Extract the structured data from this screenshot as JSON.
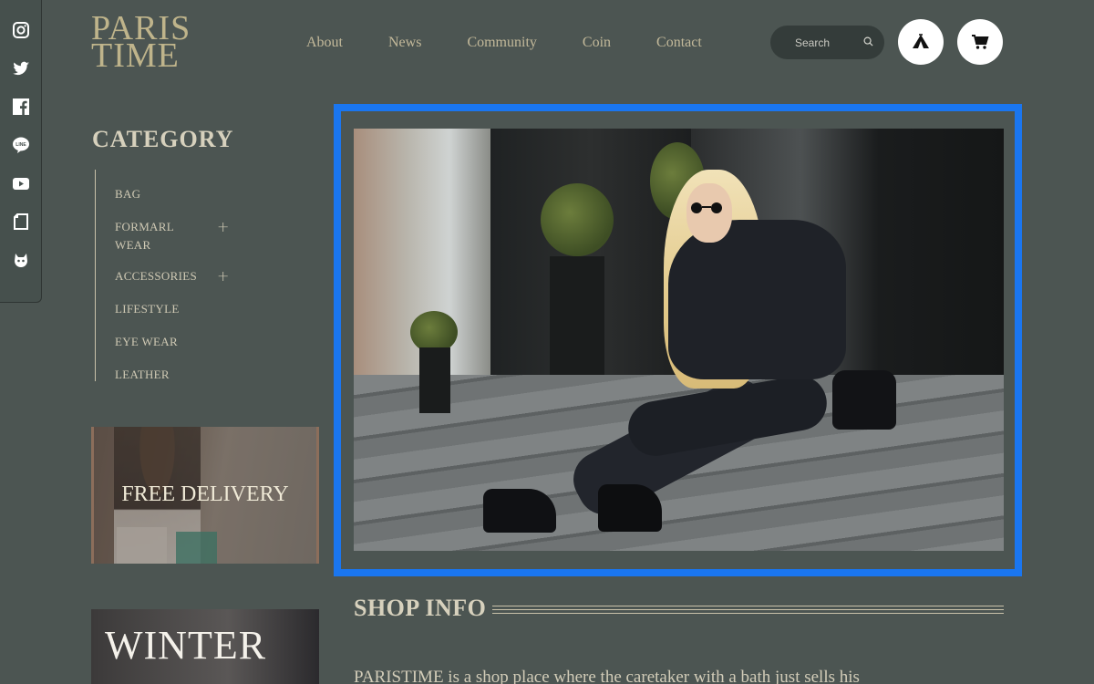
{
  "social": {
    "icons": [
      "instagram-icon",
      "twitter-icon",
      "facebook-icon",
      "line-icon",
      "youtube-icon",
      "note-icon",
      "creature-icon"
    ],
    "line_text": "LINE"
  },
  "header": {
    "logo_line1": "PARIS",
    "logo_line2": "TIME",
    "nav": [
      "About",
      "News",
      "Community",
      "Coin",
      "Contact"
    ],
    "search_placeholder": "Search"
  },
  "sidebar": {
    "title": "CATEGORY",
    "categories": [
      {
        "label": "BAG",
        "expandable": false
      },
      {
        "label": "FORMARL WEAR",
        "expandable": true
      },
      {
        "label": "ACCESSORIES",
        "expandable": true
      },
      {
        "label": "LIFESTYLE",
        "expandable": false
      },
      {
        "label": "EYE WEAR",
        "expandable": false
      },
      {
        "label": "LEATHER",
        "expandable": false
      }
    ],
    "expand_symbol": "+",
    "promo_delivery": "FREE DELIVERY",
    "promo_winter": "WINTER"
  },
  "shop_info": {
    "title": "SHOP INFO",
    "text": "PARISTIME is a shop place where the caretaker with a bath just sells his"
  },
  "colors": {
    "background": "#4c5552",
    "accent_gold": "#bfb48b",
    "highlight_frame": "#1a76f0"
  }
}
